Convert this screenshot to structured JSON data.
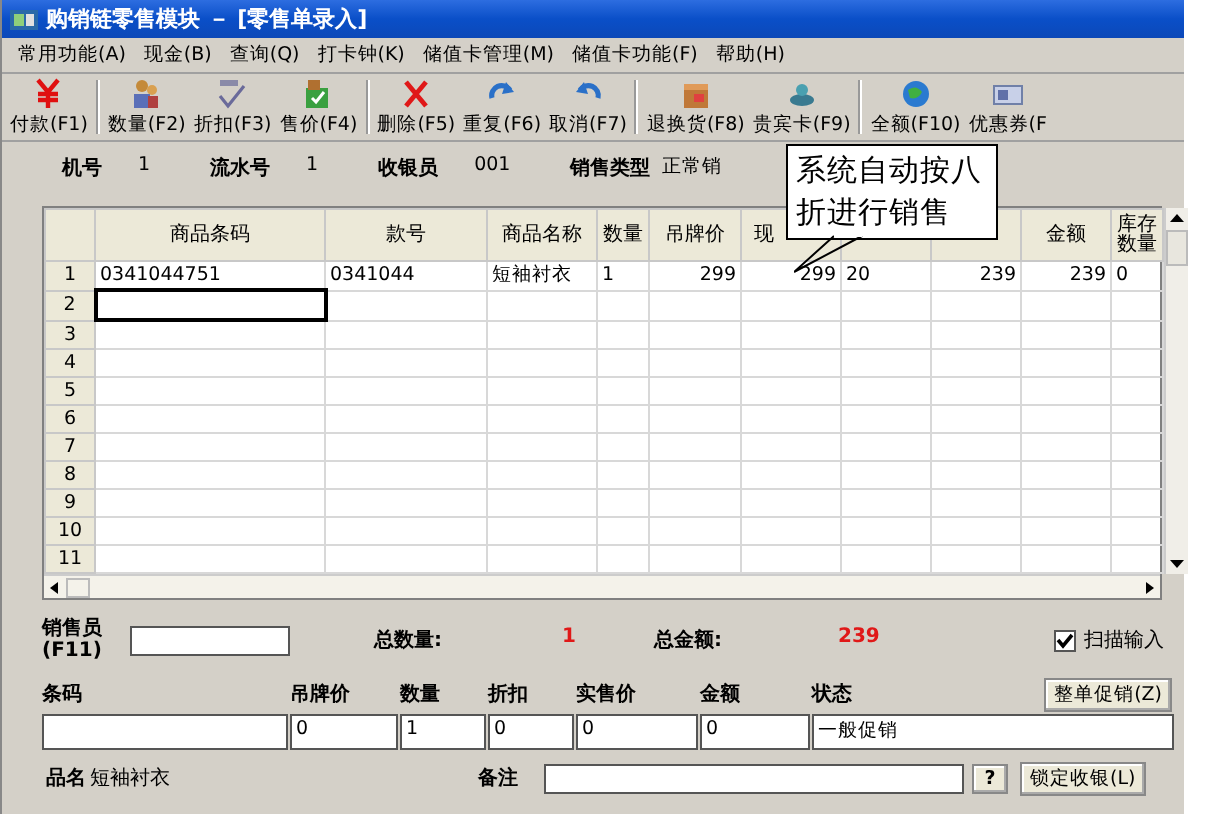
{
  "window": {
    "title": "购销链零售模块 － [零售单录入]"
  },
  "menu": [
    "常用功能(A)",
    "现金(B)",
    "查询(Q)",
    "打卡钟(K)",
    "储值卡管理(M)",
    "储值卡功能(F)",
    "帮助(H)"
  ],
  "toolbar": [
    [
      "付款(F1)"
    ],
    [
      "数量(F2)",
      "折扣(F3)",
      "售价(F4)"
    ],
    [
      "删除(F5)",
      "重复(F6)",
      "取消(F7)"
    ],
    [
      "退换货(F8)",
      "贵宾卡(F9)"
    ],
    [
      "全额(F10)",
      "优惠券(F"
    ]
  ],
  "info": [
    {
      "label": "机号",
      "value": "1"
    },
    {
      "label": "流水号",
      "value": "1"
    },
    {
      "label": "收银员",
      "value": "001"
    },
    {
      "label": "销售类型",
      "value": "正常销"
    }
  ],
  "grid": {
    "columns": [
      "商品条码",
      "款号",
      "商品名称",
      "数量",
      "吊牌价",
      "现",
      null,
      null,
      "金额",
      "库存数量"
    ],
    "rows": [
      {
        "number": "1",
        "selected": false,
        "cells": [
          "0341044751",
          "0341044",
          "短袖衬衣",
          "1",
          "299",
          "299",
          "20",
          "239",
          "239",
          "0"
        ]
      },
      {
        "number": "2",
        "selected": true
      },
      {
        "number": "3",
        "selected": false
      },
      {
        "number": "4",
        "selected": false
      },
      {
        "number": "5",
        "selected": false
      },
      {
        "number": "6",
        "selected": false
      },
      {
        "number": "7",
        "selected": false
      },
      {
        "number": "8",
        "selected": false
      },
      {
        "number": "9",
        "selected": false
      },
      {
        "number": "10",
        "selected": false
      },
      {
        "number": "11",
        "selected": false
      }
    ]
  },
  "callout": {
    "text": "系统自动按八折进行销售"
  },
  "salesperson": {
    "label": "销售员(F11)"
  },
  "totals": [
    {
      "label": "总数量:",
      "value": "1"
    },
    {
      "label": "总金额:",
      "value": "239"
    }
  ],
  "scan_input": {
    "label": "扫描输入",
    "checked": true
  },
  "entry": [
    {
      "label": "条码"
    },
    {
      "label": "吊牌价",
      "value": "0"
    },
    {
      "label": "数量",
      "value": "1"
    },
    {
      "label": "折扣",
      "value": "0"
    },
    {
      "label": "实售价",
      "value": "0"
    },
    {
      "label": "金额",
      "value": "0"
    },
    {
      "label": "状态",
      "value": "一般促销"
    }
  ],
  "promo_button": "整单促销(Z)",
  "product": {
    "label": "品名",
    "value": "短袖衬衣"
  },
  "remark": {
    "label": "备注"
  },
  "help_button": "?",
  "lock_button": "锁定收银(L)"
}
